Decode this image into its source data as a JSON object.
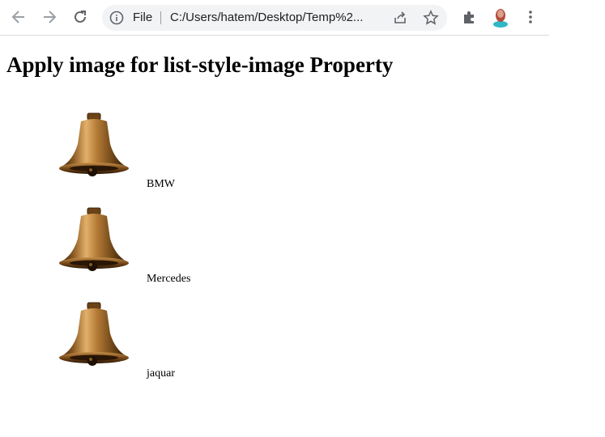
{
  "browser": {
    "file_label": "File",
    "url": "C:/Users/hatem/Desktop/Temp%2...",
    "icons": [
      "back-arrow-icon",
      "forward-arrow-icon",
      "reload-icon",
      "info-icon",
      "share-icon",
      "star-icon",
      "extensions-icon",
      "profile-avatar",
      "more-vertical-icon"
    ],
    "colors": {
      "icon": "#5f6368",
      "omnibox_bg": "#f1f3f4"
    }
  },
  "page": {
    "title": "Apply image for list-style-image Property",
    "list_items": [
      {
        "label": "BMW",
        "marker": "bell-icon"
      },
      {
        "label": "Mercedes",
        "marker": "bell-icon"
      },
      {
        "label": "jaquar",
        "marker": "bell-icon"
      }
    ]
  }
}
